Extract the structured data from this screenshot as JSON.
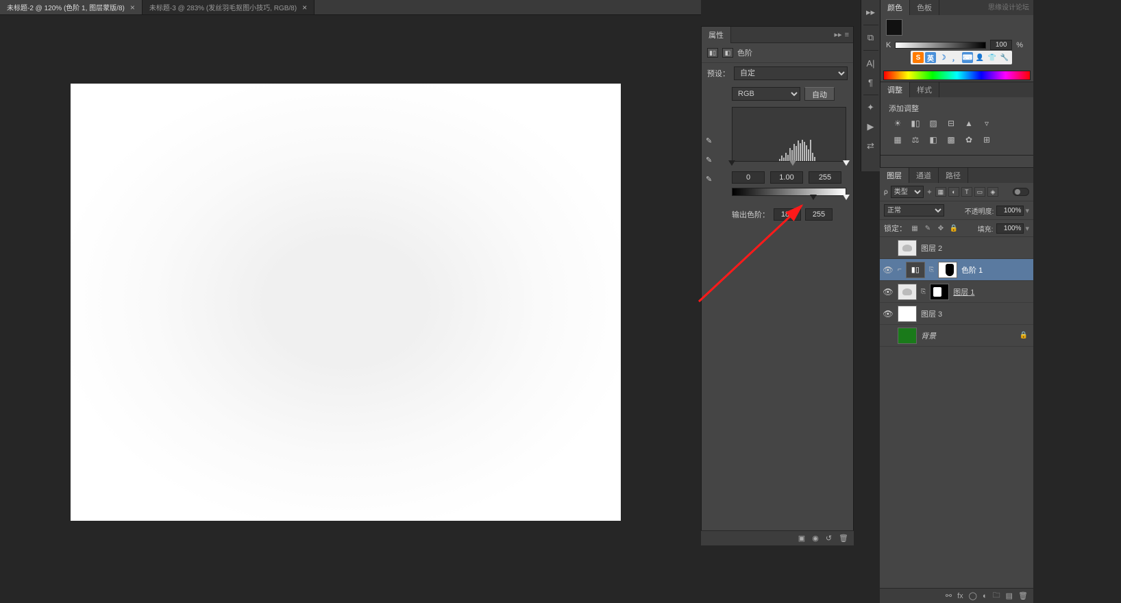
{
  "tabs": [
    {
      "label": "未标题-2 @ 120% (色阶 1, 图层蒙版/8)",
      "active": true
    },
    {
      "label": "未标题-3 @ 283% (发丝羽毛抠图小技巧, RGB/8)",
      "active": false
    }
  ],
  "properties": {
    "panel_title": "属性",
    "adjustment_name": "色阶",
    "preset_label": "预设：",
    "preset_value": "自定",
    "channel_value": "RGB",
    "auto_label": "自动",
    "input_black": "0",
    "input_mid": "1.00",
    "input_white": "255",
    "output_label": "输出色阶：",
    "output_black": "184",
    "output_white": "255"
  },
  "color_panel": {
    "tab1": "颜色",
    "tab2": "色板",
    "watermark": "思缘设计论坛",
    "k_label": "K",
    "k_value": "100",
    "k_pct": "%"
  },
  "adjustments_panel": {
    "tab1": "调整",
    "tab2": "样式",
    "heading": "添加调整"
  },
  "layers_panel": {
    "tab1": "图层",
    "tab2": "通道",
    "tab3": "路径",
    "filter_kind": "类型",
    "blend_mode": "正常",
    "opacity_label": "不透明度:",
    "opacity_value": "100%",
    "lock_label": "锁定：",
    "fill_label": "填充:",
    "fill_value": "100%",
    "layers": [
      {
        "name": "图层 2",
        "visible": false,
        "selected": false,
        "thumb": "feather"
      },
      {
        "name": "色阶 1",
        "visible": true,
        "selected": true,
        "clipped": true,
        "adj": true
      },
      {
        "name": "图层 1",
        "visible": true,
        "selected": false,
        "thumb": "feather",
        "mask": "black-mask",
        "underline": true
      },
      {
        "name": "图层 3",
        "visible": true,
        "selected": false,
        "thumb": "white"
      },
      {
        "name": "背景",
        "visible": false,
        "selected": false,
        "thumb": "green",
        "locked": true
      }
    ]
  },
  "ime": {
    "s": "S",
    "cn": "英"
  }
}
